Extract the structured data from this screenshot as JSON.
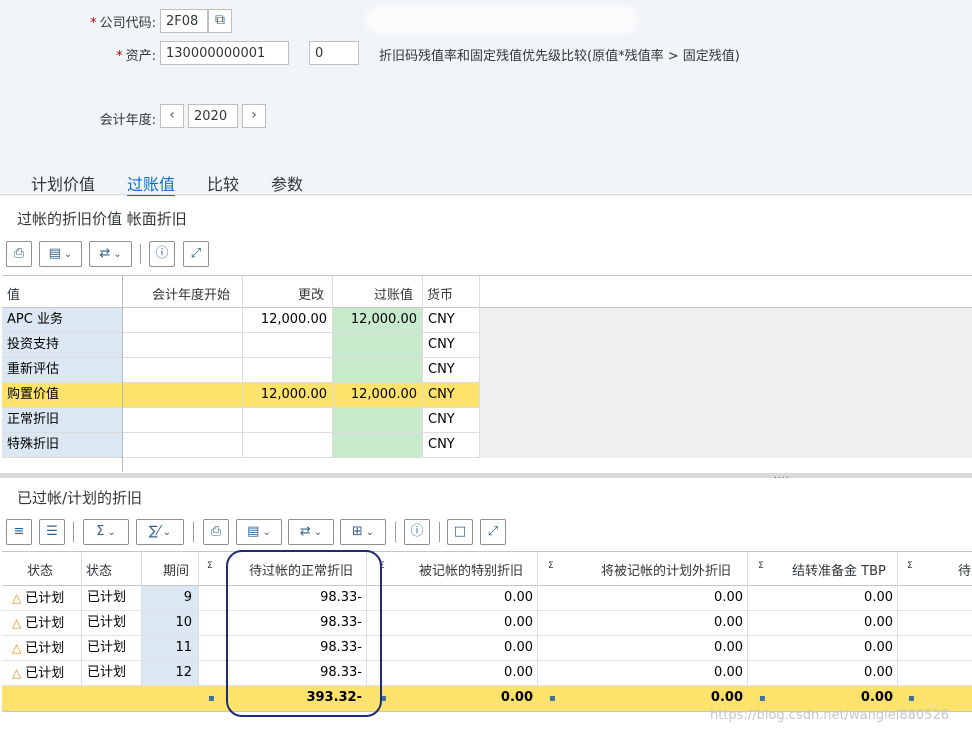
{
  "header": {
    "company_code_label": "公司代码:",
    "company_code_value": "2F08",
    "asset_label": "资产:",
    "asset_value": "130000000001",
    "sub_number_value": "0",
    "info_text": "折旧码残值率和固定残值优先级比较(原值*残值率 > 固定残值)",
    "fiscal_year_label": "会计年度:",
    "fiscal_year_value": "2020"
  },
  "tabs": [
    "计划价值",
    "过账值",
    "比较",
    "参数"
  ],
  "section1": {
    "title": "过帐的折旧价值 帐面折旧",
    "columns": [
      "值",
      "会计年度开始",
      "更改",
      "过账值",
      "货币"
    ],
    "rows": [
      {
        "label": "APC 业务",
        "start": "",
        "change": "12,000.00",
        "posted": "12,000.00",
        "currency": "CNY"
      },
      {
        "label": "投资支持",
        "start": "",
        "change": "",
        "posted": "",
        "currency": "CNY"
      },
      {
        "label": "重新评估",
        "start": "",
        "change": "",
        "posted": "",
        "currency": "CNY"
      },
      {
        "label": "购置价值",
        "start": "",
        "change": "12,000.00",
        "posted": "12,000.00",
        "currency": "CNY"
      },
      {
        "label": "正常折旧",
        "start": "",
        "change": "",
        "posted": "",
        "currency": "CNY"
      },
      {
        "label": "特殊折旧",
        "start": "",
        "change": "",
        "posted": "",
        "currency": "CNY"
      }
    ]
  },
  "section2": {
    "title": "已过帐/计划的折旧",
    "columns": [
      "状态",
      "状态",
      "期间",
      "待过帐的正常折旧",
      "被记帐的特别折旧",
      "将被记帐的计划外折旧",
      "结转准备金 TBP",
      "待"
    ],
    "sigma": "Σ",
    "rows": [
      {
        "status_icon": "△",
        "status": "已计划",
        "status2": "已计划",
        "period": "9",
        "normal": "98.33-",
        "special": "0.00",
        "unplanned": "0.00",
        "reserve": "0.00"
      },
      {
        "status_icon": "△",
        "status": "已计划",
        "status2": "已计划",
        "period": "10",
        "normal": "98.33-",
        "special": "0.00",
        "unplanned": "0.00",
        "reserve": "0.00"
      },
      {
        "status_icon": "△",
        "status": "已计划",
        "status2": "已计划",
        "period": "11",
        "normal": "98.33-",
        "special": "0.00",
        "unplanned": "0.00",
        "reserve": "0.00"
      },
      {
        "status_icon": "△",
        "status": "已计划",
        "status2": "已计划",
        "period": "12",
        "normal": "98.33-",
        "special": "0.00",
        "unplanned": "0.00",
        "reserve": "0.00"
      }
    ],
    "totals": {
      "normal": "393.32-",
      "special": "0.00",
      "unplanned": "0.00",
      "reserve": "0.00"
    }
  },
  "watermark": "https://blog.csdn.net/wanglei880526",
  "colors": {
    "accent": "#0a6ed1",
    "key_cell": "#dbe7f2",
    "posted_cell": "#c7e9cc",
    "highlight_row": "#fde26b"
  }
}
